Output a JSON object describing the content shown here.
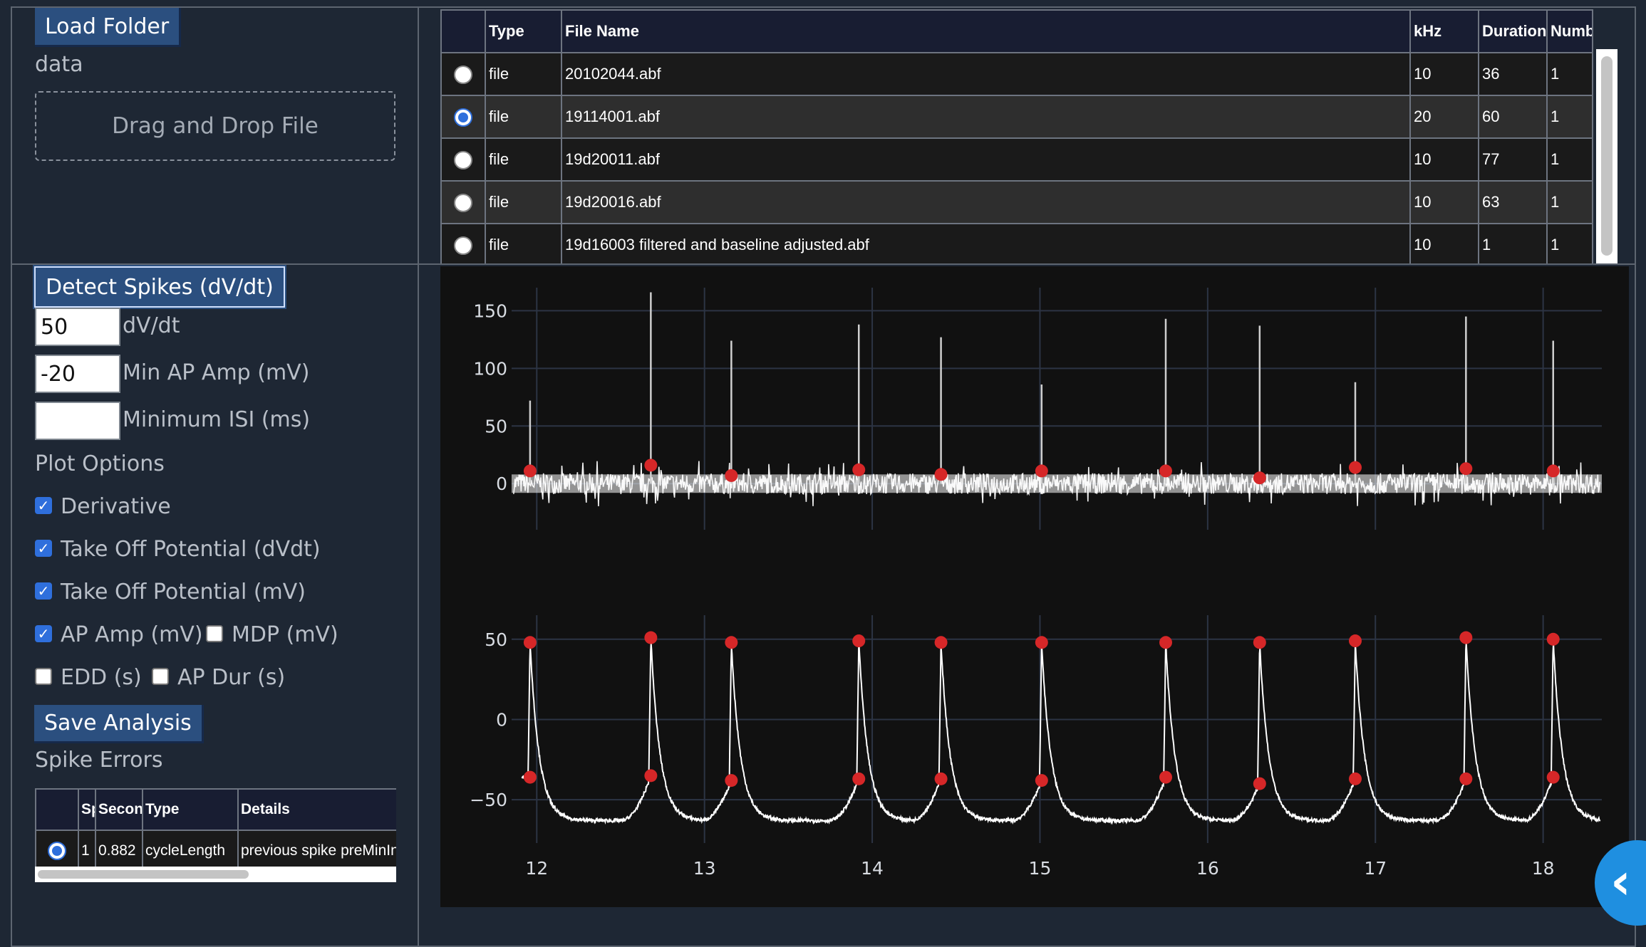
{
  "file_panel": {
    "load_folder_label": "Load Folder",
    "folder_name": "data",
    "dropzone_label": "Drag and Drop File"
  },
  "file_table": {
    "headers": [
      "",
      "Type",
      "File Name",
      "kHz",
      "Duration",
      "Numb"
    ],
    "rows": [
      {
        "selected": false,
        "type": "file",
        "name": "20102044.abf",
        "khz": "10",
        "duration": "36",
        "num": "1"
      },
      {
        "selected": true,
        "type": "file",
        "name": "19114001.abf",
        "khz": "20",
        "duration": "60",
        "num": "1"
      },
      {
        "selected": false,
        "type": "file",
        "name": "19d20011.abf",
        "khz": "10",
        "duration": "77",
        "num": "1"
      },
      {
        "selected": false,
        "type": "file",
        "name": "19d20016.abf",
        "khz": "10",
        "duration": "63",
        "num": "1"
      },
      {
        "selected": false,
        "type": "file",
        "name": "19d16003 filtered and baseline adjusted.abf",
        "khz": "10",
        "duration": "1",
        "num": "1"
      }
    ]
  },
  "detection": {
    "detect_label": "Detect Spikes (dV/dt)",
    "dvdt_value": "50",
    "dvdt_label": "dV/dt",
    "min_amp_value": "-20",
    "min_amp_label": "Min AP Amp (mV)",
    "min_isi_value": "",
    "min_isi_label": "Minimum ISI (ms)"
  },
  "plot_options": {
    "heading": "Plot Options",
    "derivative": {
      "label": "Derivative",
      "checked": true
    },
    "takeoff_dvdt": {
      "label": "Take Off Potential (dVdt)",
      "checked": true
    },
    "takeoff_mv": {
      "label": "Take Off Potential (mV)",
      "checked": true
    },
    "ap_amp": {
      "label": "AP Amp (mV)",
      "checked": true
    },
    "mdp": {
      "label": "MDP (mV)",
      "checked": false
    },
    "edd": {
      "label": "EDD (s)",
      "checked": false
    },
    "ap_dur": {
      "label": "AP Dur (s)",
      "checked": false
    }
  },
  "analysis": {
    "save_label": "Save Analysis",
    "errors_heading": "Spike Errors"
  },
  "error_table": {
    "headers": [
      "",
      "Spike",
      "Seconds",
      "Type",
      "Details"
    ],
    "rows": [
      {
        "selected": true,
        "spike": "1",
        "seconds": "0.882",
        "type": "cycleLength",
        "details": "previous spike preMinIntervalError"
      }
    ]
  },
  "colors": {
    "background": "#1e2734",
    "plot_bg": "#111111",
    "trace": "#ffffff",
    "marker": "#d62728",
    "accent": "#2b4f7f",
    "fab": "#1f8fe0"
  },
  "fab_icon": "chevron-left-icon",
  "chart_data": [
    {
      "type": "line",
      "title": "",
      "xlabel": "",
      "ylabel": "",
      "xlim": [
        11.85,
        18.35
      ],
      "ylim": [
        -40,
        170
      ],
      "yticks": [
        0,
        50,
        100,
        150
      ],
      "grid": true,
      "series": [
        {
          "kind": "dvdt-trace",
          "noise_amp": 9,
          "spike_x": [
            11.96,
            12.68,
            13.16,
            13.92,
            14.41,
            15.01,
            15.75,
            16.31,
            16.88,
            17.54,
            18.06
          ],
          "spike_peak": [
            72,
            166,
            124,
            138,
            127,
            86,
            143,
            137,
            88,
            145,
            124
          ]
        },
        {
          "kind": "takeoff-markers",
          "x": [
            11.96,
            12.68,
            13.16,
            13.92,
            14.41,
            15.01,
            15.75,
            16.31,
            16.88,
            17.54,
            18.06
          ],
          "y": [
            11,
            16,
            7,
            12,
            8,
            11,
            11,
            5,
            14,
            13,
            11
          ]
        }
      ]
    },
    {
      "type": "line",
      "title": "",
      "xlabel": "",
      "ylabel": "",
      "xlim": [
        11.85,
        18.35
      ],
      "ylim": [
        -77,
        65
      ],
      "xticks": [
        12,
        13,
        14,
        15,
        16,
        17,
        18
      ],
      "yticks": [
        -50,
        0,
        50
      ],
      "grid": true,
      "series": [
        {
          "kind": "voltage-trace",
          "mdp": -63,
          "takeoff": -36
        },
        {
          "kind": "peak-markers",
          "x": [
            11.96,
            12.68,
            13.16,
            13.92,
            14.41,
            15.01,
            15.75,
            16.31,
            16.88,
            17.54,
            18.06
          ],
          "y": [
            48,
            51,
            48,
            49,
            48,
            48,
            48,
            48,
            49,
            51,
            50
          ]
        },
        {
          "kind": "takeoff-markers",
          "x": [
            11.96,
            12.68,
            13.16,
            13.92,
            14.41,
            15.01,
            15.75,
            16.31,
            16.88,
            17.54,
            18.06
          ],
          "y": [
            -36,
            -35,
            -38,
            -37,
            -37,
            -38,
            -36,
            -40,
            -37,
            -37,
            -36
          ]
        }
      ]
    }
  ]
}
